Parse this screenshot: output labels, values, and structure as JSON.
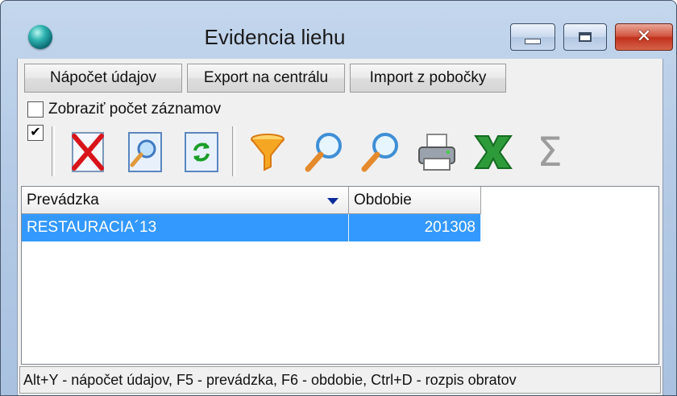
{
  "window": {
    "title": "Evidencia liehu",
    "close_glyph": "✕"
  },
  "buttons": {
    "recalc": "Nápočet údajov",
    "export": "Export na centrálu",
    "import": "Import z pobočky"
  },
  "show_count": {
    "label": "Zobraziť počet záznamov",
    "checked": false
  },
  "toolbar": {
    "check_mark": "✔",
    "sigma": "Σ",
    "icons": [
      "delete-icon",
      "preview-icon",
      "refresh-icon",
      "filter-icon",
      "search-icon",
      "search-next-icon",
      "print-icon",
      "excel-icon",
      "sum-icon"
    ]
  },
  "grid": {
    "columns": [
      "Prevádzka",
      "Obdobie"
    ],
    "sorted_column": "Prevádzka",
    "rows": [
      {
        "prevadzka": "RESTAURACIA´13",
        "obdobie": "201308",
        "selected": true
      }
    ]
  },
  "status": "Alt+Y - nápočet údajov, F5 - prevádzka, F6 - obdobie, Ctrl+D - rozpis obratov",
  "colors": {
    "selection": "#3399ff",
    "sort_arrow": "#0a2a9a",
    "close_button": "#c0301c"
  }
}
